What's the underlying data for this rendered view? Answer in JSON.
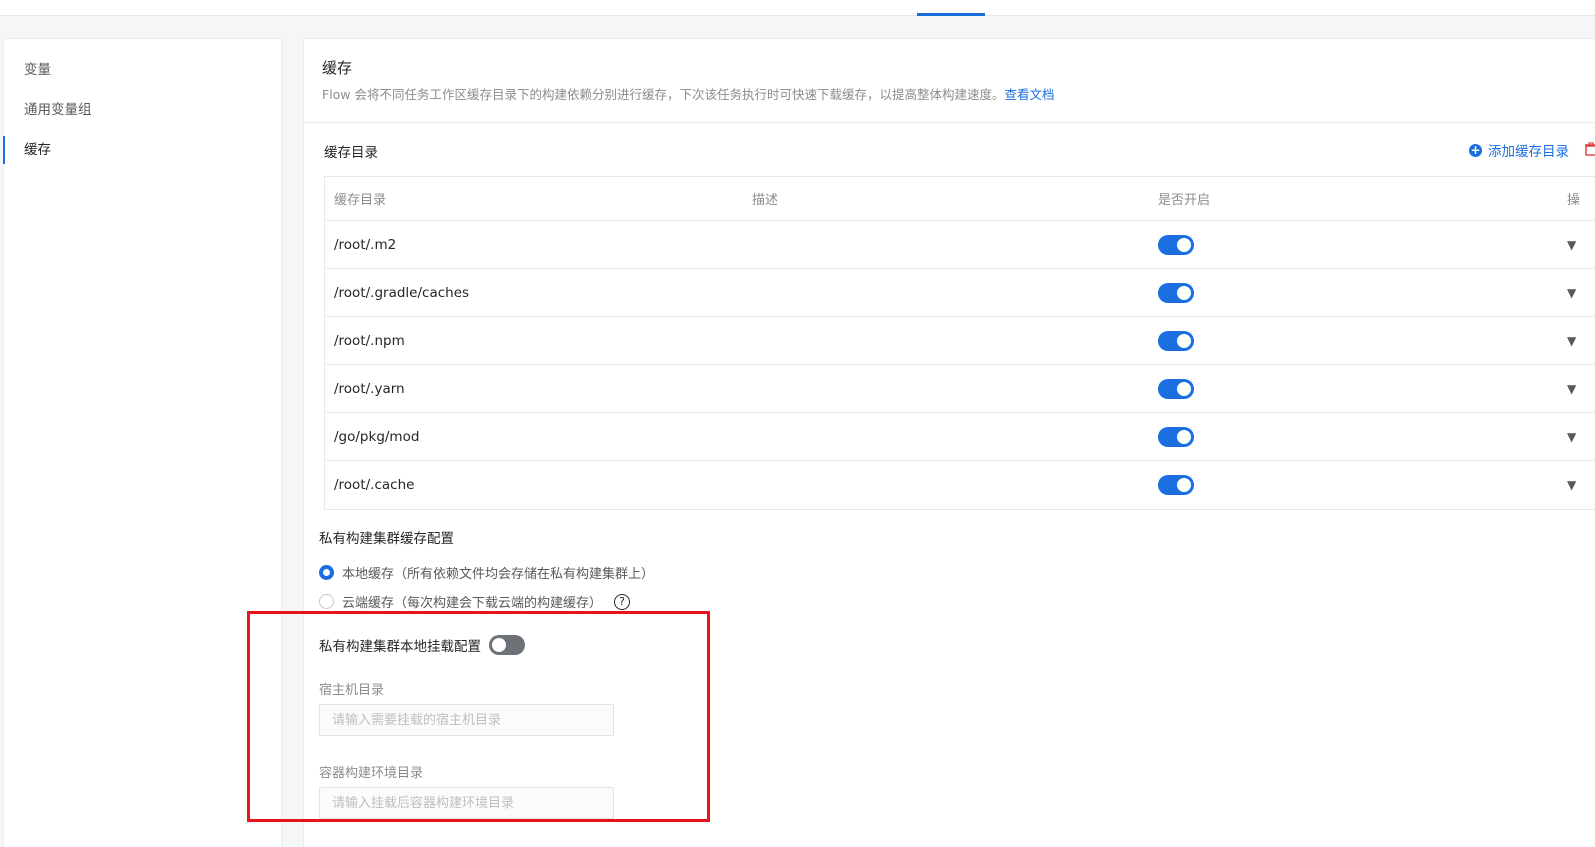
{
  "sidebar": {
    "items": [
      {
        "label": "变量"
      },
      {
        "label": "通用变量组"
      },
      {
        "label": "缓存"
      }
    ]
  },
  "main": {
    "title": "缓存",
    "description": "Flow 会将不同任务工作区缓存目录下的构建依赖分别进行缓存，下次该任务执行时可快速下载缓存，以提高整体构建速度。",
    "doc_link": "查看文档"
  },
  "cache_dirs": {
    "section_title": "缓存目录",
    "add_label": "添加缓存目录",
    "columns": {
      "dir": "缓存目录",
      "desc": "描述",
      "enabled": "是否开启",
      "op": "操"
    },
    "rows": [
      {
        "dir": "/root/.m2",
        "desc": "",
        "enabled": true
      },
      {
        "dir": "/root/.gradle/caches",
        "desc": "",
        "enabled": true
      },
      {
        "dir": "/root/.npm",
        "desc": "",
        "enabled": true
      },
      {
        "dir": "/root/.yarn",
        "desc": "",
        "enabled": true
      },
      {
        "dir": "/go/pkg/mod",
        "desc": "",
        "enabled": true
      },
      {
        "dir": "/root/.cache",
        "desc": "",
        "enabled": true
      }
    ]
  },
  "private_cluster": {
    "title": "私有构建集群缓存配置",
    "options": [
      {
        "label": "本地缓存（所有依赖文件均会存储在私有构建集群上）",
        "checked": true
      },
      {
        "label": "云端缓存（每次构建会下载云端的构建缓存）",
        "checked": false
      }
    ],
    "help_glyph": "?",
    "mount_label": "私有构建集群本地挂载配置",
    "mount_enabled": false,
    "host_dir_label": "宿主机目录",
    "host_dir_placeholder": "请输入需要挂载的宿主机目录",
    "container_dir_label": "容器构建环境目录",
    "container_dir_placeholder": "请输入挂载后容器构建环境目录"
  },
  "colors": {
    "accent": "#1b6ee0",
    "highlight_box": "#e8141b",
    "switch_off": "#6d7178"
  }
}
